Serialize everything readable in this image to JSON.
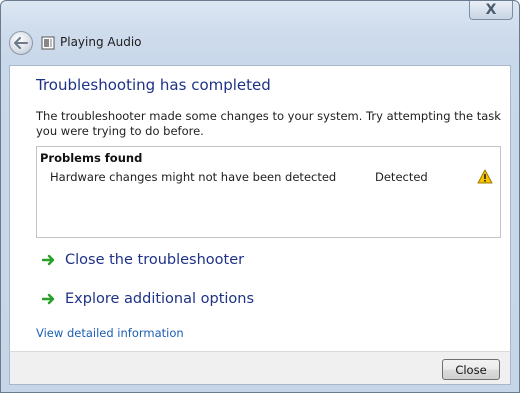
{
  "window": {
    "title": "Playing Audio",
    "close_glyph": "X"
  },
  "content": {
    "heading": "Troubleshooting has completed",
    "description": "The troubleshooter made some changes to your system. Try attempting the task you were trying to do before.",
    "problems": {
      "header": "Problems found",
      "rows": [
        {
          "name": "Hardware changes might not have been detected",
          "status": "Detected",
          "icon": "warning-icon"
        }
      ]
    },
    "actions": [
      {
        "label": "Close the troubleshooter",
        "icon": "green-arrow-icon"
      },
      {
        "label": "Explore additional options",
        "icon": "green-arrow-icon"
      }
    ],
    "details_link": "View detailed information"
  },
  "footer": {
    "close_label": "Close"
  },
  "colors": {
    "heading": "#1e3287",
    "link": "#1c5fb4",
    "arrow": "#2aa02a",
    "warning": "#f2c200"
  }
}
